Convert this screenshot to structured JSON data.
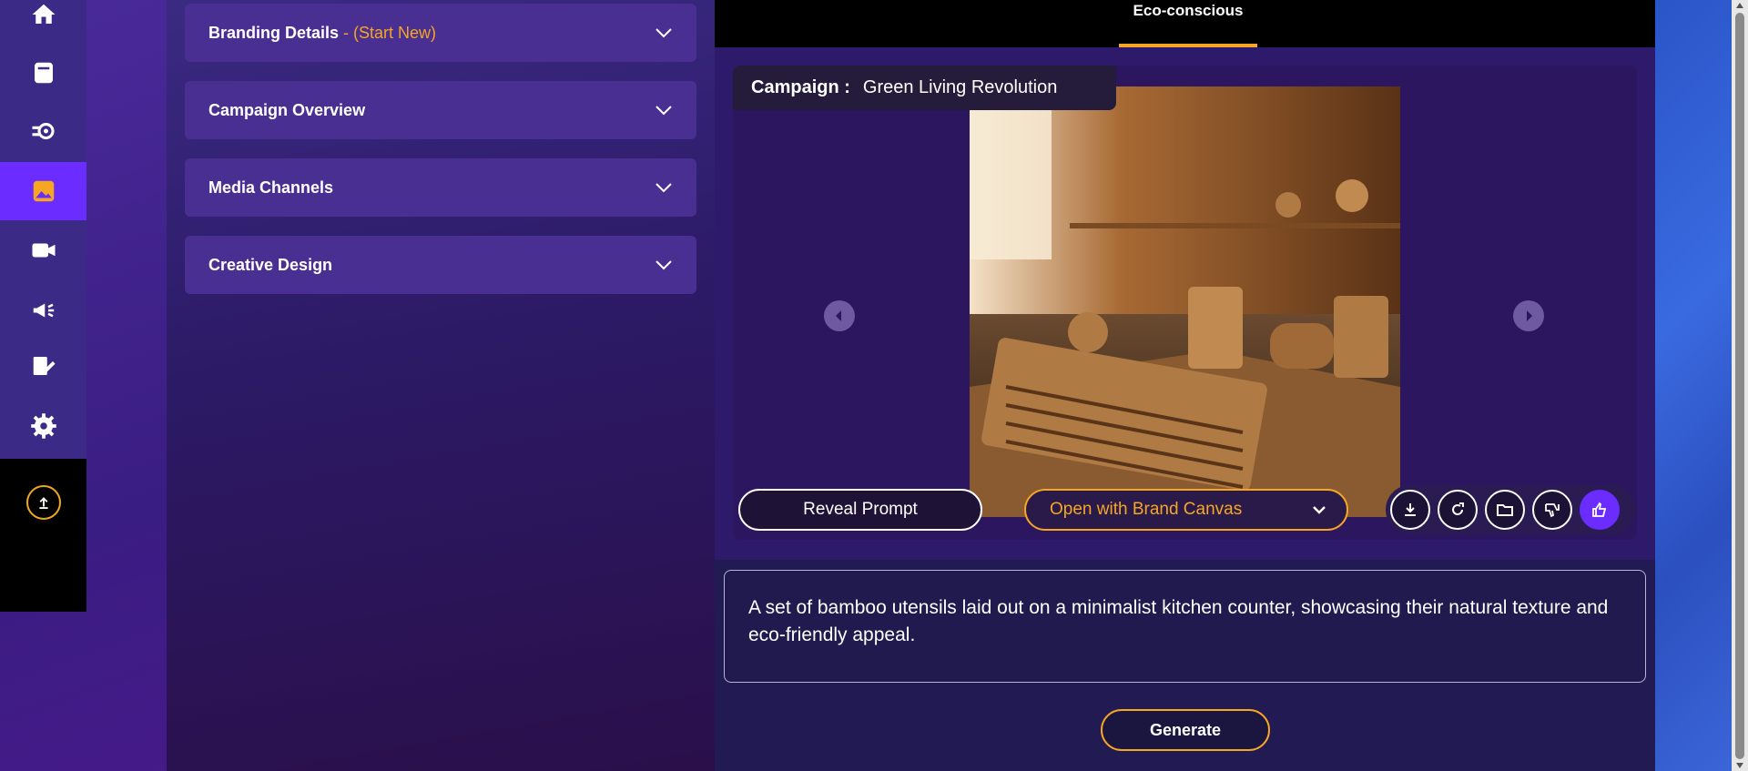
{
  "sidebar": {
    "items": [
      {
        "icon": "home-icon"
      },
      {
        "icon": "document-icon"
      },
      {
        "icon": "gear-refresh-icon"
      },
      {
        "icon": "image-icon",
        "active": true
      },
      {
        "icon": "video-icon"
      },
      {
        "icon": "megaphone-icon"
      },
      {
        "icon": "edit-note-icon"
      },
      {
        "icon": "settings-icon"
      }
    ],
    "upload_icon": "upload-icon"
  },
  "accordion": [
    {
      "title": "Branding Details",
      "accent": "- (Start New)"
    },
    {
      "title": "Campaign Overview",
      "accent": ""
    },
    {
      "title": "Media Channels",
      "accent": ""
    },
    {
      "title": "Creative Design",
      "accent": ""
    }
  ],
  "tabs": {
    "active_label": "Eco-conscious"
  },
  "campaign": {
    "label": "Campaign :",
    "value": "Green Living Revolution"
  },
  "viewer": {
    "reveal_label": "Reveal Prompt",
    "brand_canvas_label": "Open with Brand Canvas",
    "actions": [
      "download-icon",
      "refresh-icon",
      "folder-icon",
      "thumbs-down-icon",
      "thumbs-up-icon"
    ]
  },
  "prompt": {
    "text": "A set of bamboo utensils laid out on a minimalist kitchen counter, showcasing their natural texture and eco-friendly appeal."
  },
  "generate_label": "Generate",
  "colors": {
    "accent": "#f5a623",
    "active": "#6a2cff"
  }
}
